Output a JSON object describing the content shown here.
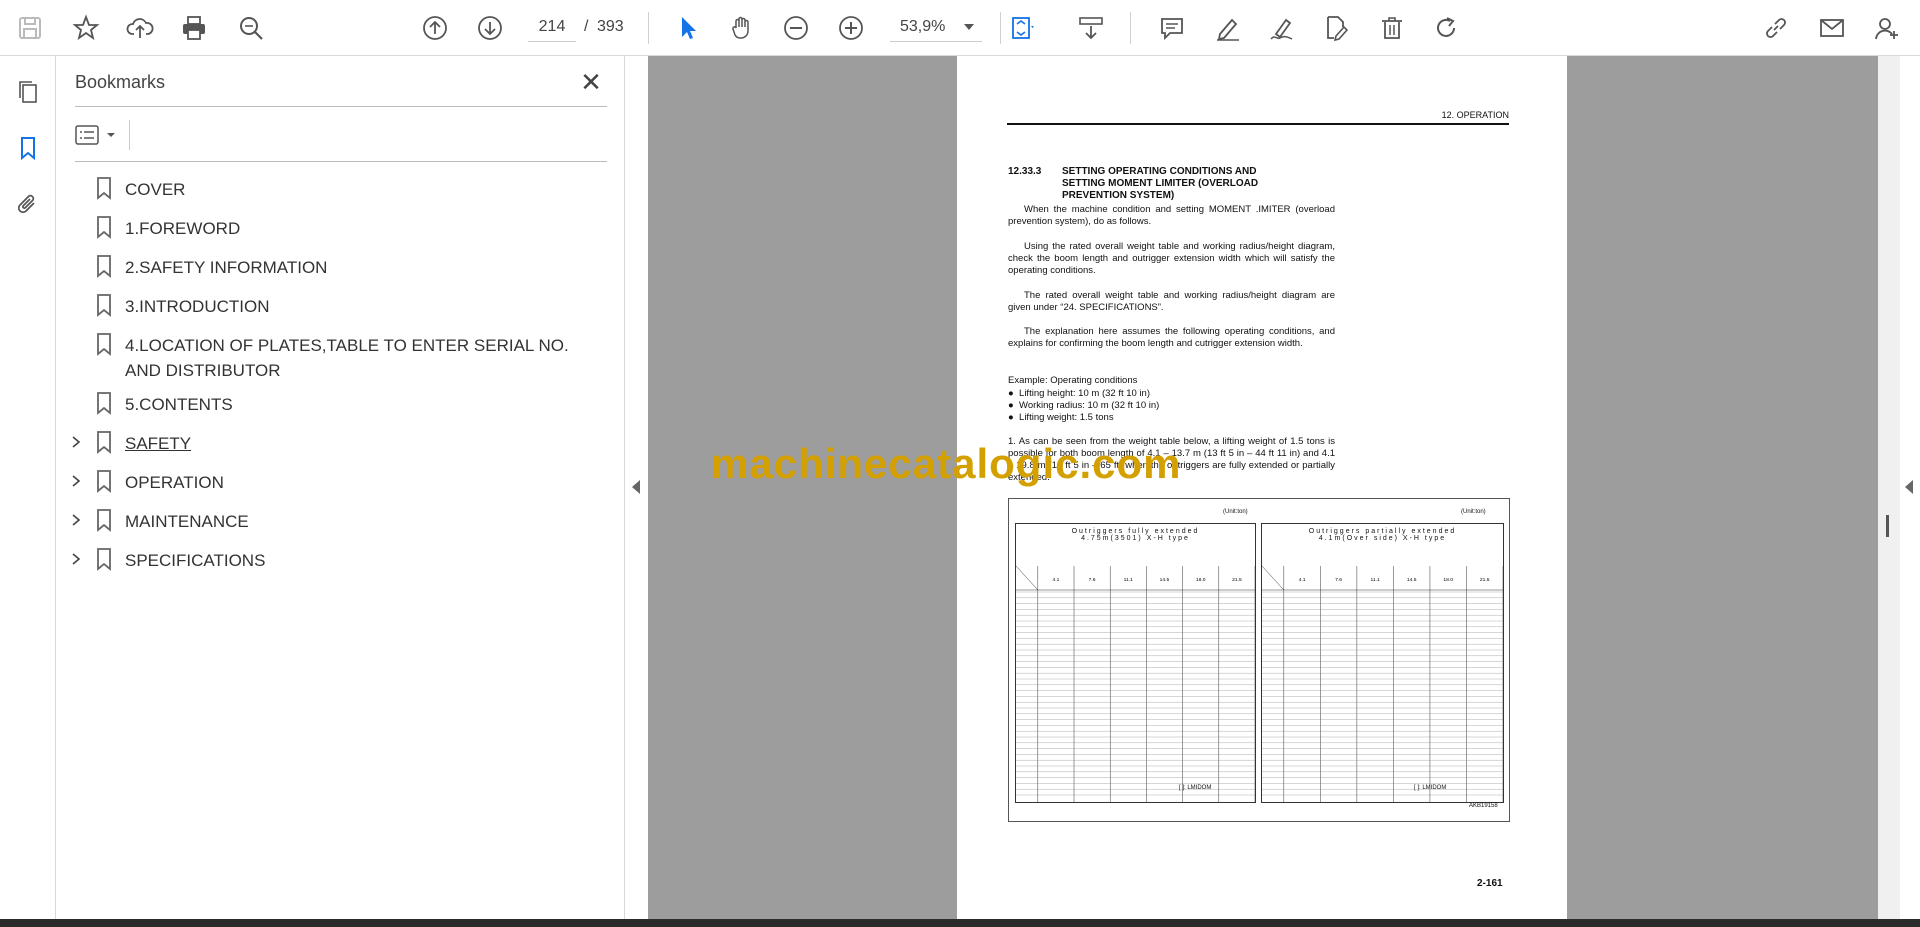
{
  "toolbar": {
    "page_current": "214",
    "page_total_sep": "/",
    "page_total": "393",
    "zoom": "53,9%"
  },
  "bookmarks_panel": {
    "title": "Bookmarks",
    "items": [
      {
        "label": "COVER",
        "expandable": false
      },
      {
        "label": "1.FOREWORD",
        "expandable": false
      },
      {
        "label": "2.SAFETY INFORMATION",
        "expandable": false
      },
      {
        "label": "3.INTRODUCTION",
        "expandable": false
      },
      {
        "label": "4.LOCATION OF PLATES,TABLE TO ENTER SERIAL NO. AND DISTRIBUTOR",
        "expandable": false
      },
      {
        "label": "5.CONTENTS",
        "expandable": false
      },
      {
        "label": "SAFETY",
        "expandable": true
      },
      {
        "label": "OPERATION",
        "expandable": true
      },
      {
        "label": "MAINTENANCE",
        "expandable": true
      },
      {
        "label": "SPECIFICATIONS",
        "expandable": true
      }
    ]
  },
  "document": {
    "header": "12. OPERATION",
    "section_number": "12.33.3",
    "section_title": "SETTING OPERATING CONDITIONS AND SETTING MOMENT LIMITER (OVERLOAD PREVENTION SYSTEM)",
    "para1": "When the machine condition and setting MOMENT .IMITER (overload prevention system), do as follows.",
    "para2": "Using the rated overall weight table and working radius/height diagram, check the boom length and outrigger extension width which will satisfy the operating conditions.",
    "para3": "The rated overall weight table and working radius/height diagram are given under “24. SPECIFICATIONS”.",
    "para4": "The explanation here assumes the following operating conditions, and explains for confirming the boom length and cutrigger extension width.",
    "example_title": "Example: Operating conditions",
    "bullet1": "Lifting height: 10 m (32 ft 10 in)",
    "bullet2": "Working radius: 10 m (32 ft 10 in)",
    "bullet3": "Lifting weight: 1.5 tons",
    "step1": "1.  As can be seen from the weight table below, a lifting weight of 1.5 tons is possible for both boom length of 4.1 – 13.7 m (13 ft 5 in – 44 ft 11 in) and 4.1 – 19.8 m (13 ft 5 in – 65 ft) when the outriggers are fully extended or partially extended.",
    "table_left_title": "Outriggers fully extended",
    "table_left_sub": "4.75m(3501)  X-H type",
    "table_right_title": "Outriggers partially extended",
    "table_right_sub": "4.1m(Over side)  X-H type",
    "unit_label": "(Unit:ton)",
    "boom_lengths": [
      "4.1",
      "7.6",
      "11.1",
      "14.5",
      "18.0",
      "21.5"
    ],
    "lmi_note": "[ ]: LMIDOM",
    "figure_id": "AKB19158",
    "page_number": "2-161",
    "watermark": "machinecatalogic.com"
  }
}
